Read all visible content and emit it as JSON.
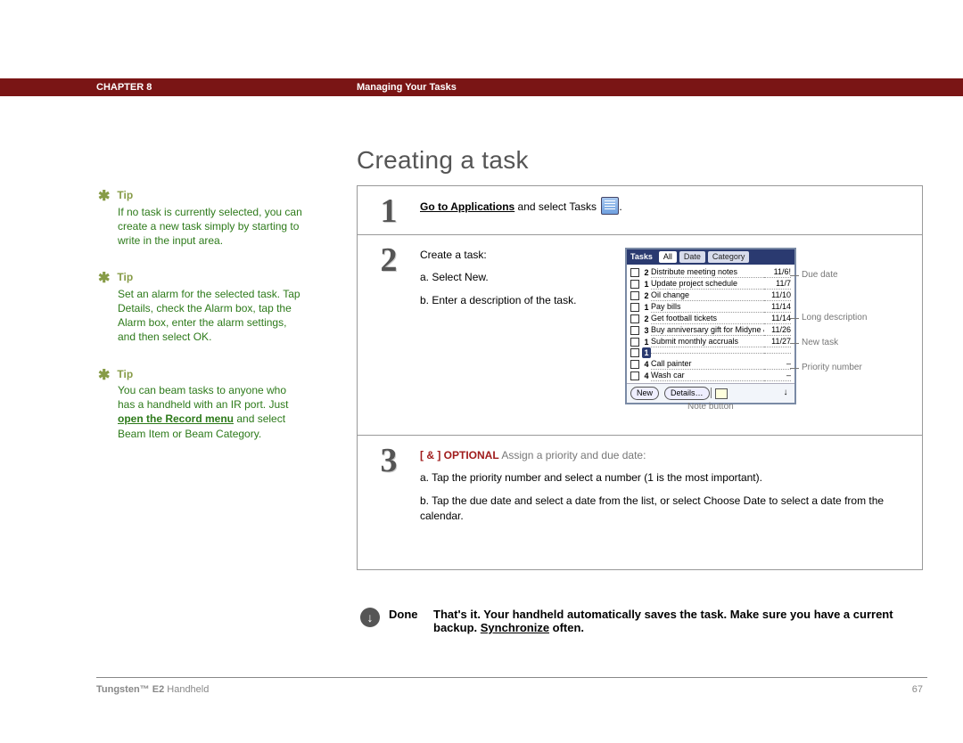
{
  "header": {
    "chapter": "CHAPTER 8",
    "title": "Managing Your Tasks"
  },
  "page_title": "Creating a task",
  "tips": [
    {
      "label": "Tip",
      "body": "If no task is currently selected, you can create a new task simply by starting to write in the input area."
    },
    {
      "label": "Tip",
      "body": "Set an alarm for the selected task. Tap Details, check the Alarm box, tap the Alarm box, enter the alarm settings, and then select OK."
    },
    {
      "label": "Tip",
      "body_pre": "You can beam tasks to anyone who has a handheld with an IR port. Just ",
      "link": "open the Record menu",
      "body_post": " and select Beam Item or Beam Category."
    }
  ],
  "steps": {
    "s1": {
      "num": "1",
      "link": "Go to Applications",
      "after": " and select Tasks ",
      "period": "."
    },
    "s2": {
      "num": "2",
      "intro": "Create a task:",
      "a": "a.  Select New.",
      "b": "b.  Enter a description of the task."
    },
    "s3": {
      "num": "3",
      "opt_marker": "[ & ]  OPTIONAL",
      "opt_text": "   Assign a priority and due date:",
      "a": "a.  Tap the priority number and select a number (1 is the most important).",
      "b": "b.  Tap the due date and select a date from the list, or select Choose Date to select a date from the calendar."
    }
  },
  "device": {
    "title": "Tasks",
    "tabs": [
      "All",
      "Date",
      "Category"
    ],
    "rows": [
      {
        "pri": "2",
        "desc": "Distribute meeting notes",
        "date": "11/6!"
      },
      {
        "pri": "1",
        "desc": "Update project schedule",
        "date": "11/7"
      },
      {
        "pri": "2",
        "desc": "Oil change",
        "date": "11/10"
      },
      {
        "pri": "1",
        "desc": "Pay bills",
        "date": "11/14"
      },
      {
        "pri": "2",
        "desc": "Get football tickets",
        "date": "11/14"
      },
      {
        "pri": "3",
        "desc": "Buy anniversary gift for Midyne & Greg",
        "date": "11/26"
      },
      {
        "pri": "1",
        "desc": "Submit monthly accruals",
        "date": "11/27"
      },
      {
        "pri": "1",
        "desc": "",
        "date": "",
        "highlight": true
      },
      {
        "pri": "4",
        "desc": "Call painter",
        "date": "–"
      },
      {
        "pri": "4",
        "desc": "Wash car",
        "date": "–"
      }
    ],
    "buttons": {
      "new": "New",
      "details": "Details…"
    },
    "callouts": {
      "due_date": "Due date",
      "long_desc": "Long description",
      "new_task": "New task",
      "priority": "Priority number",
      "note_btn": "Note button"
    }
  },
  "done": {
    "label": "Done",
    "text_pre": "That's it. Your handheld automatically saves the task. Make sure you have a current backup. ",
    "link": "Synchronize",
    "text_post": " often."
  },
  "footer": {
    "product_bold": "Tungsten™ E2",
    "product_rest": " Handheld",
    "page": "67"
  }
}
